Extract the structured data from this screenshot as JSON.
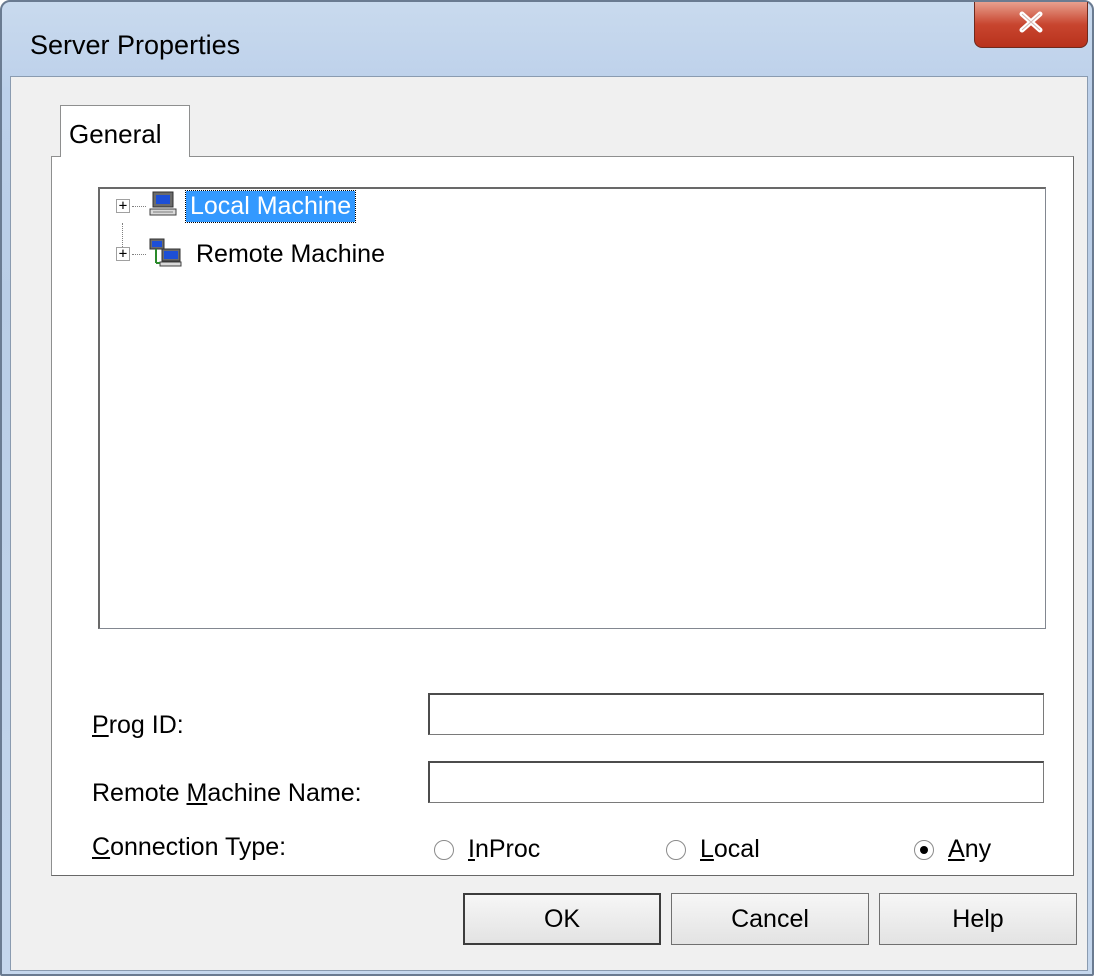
{
  "window": {
    "title": "Server Properties",
    "close_glyph": "X"
  },
  "tabs": [
    {
      "label": "General",
      "selected": true
    }
  ],
  "tree": {
    "nodes": [
      {
        "label": "Local Machine",
        "icon": "computer-icon",
        "expander": "+",
        "selected": true
      },
      {
        "label": "Remote Machine",
        "icon": "network-computers-icon",
        "expander": "+",
        "selected": false
      }
    ]
  },
  "form": {
    "prog_id": {
      "label_pre": "",
      "label_accel": "P",
      "label_post": "rog ID:",
      "value": ""
    },
    "remote_machine_name": {
      "label_pre": "Remote ",
      "label_accel": "M",
      "label_post": "achine Name:",
      "value": ""
    },
    "connection_type": {
      "label_pre": "",
      "label_accel": "C",
      "label_post": "onnection Type:",
      "options": [
        {
          "accel": "I",
          "rest": "nProc",
          "checked": false
        },
        {
          "accel": "L",
          "rest": "ocal",
          "checked": false
        },
        {
          "accel": "A",
          "rest": "ny",
          "checked": true
        }
      ]
    }
  },
  "buttons": {
    "ok": "OK",
    "cancel": "Cancel",
    "help": "Help"
  },
  "colors": {
    "selection": "#3399ff",
    "close_button": "#c8452f",
    "frame": "#bcd0ea"
  }
}
